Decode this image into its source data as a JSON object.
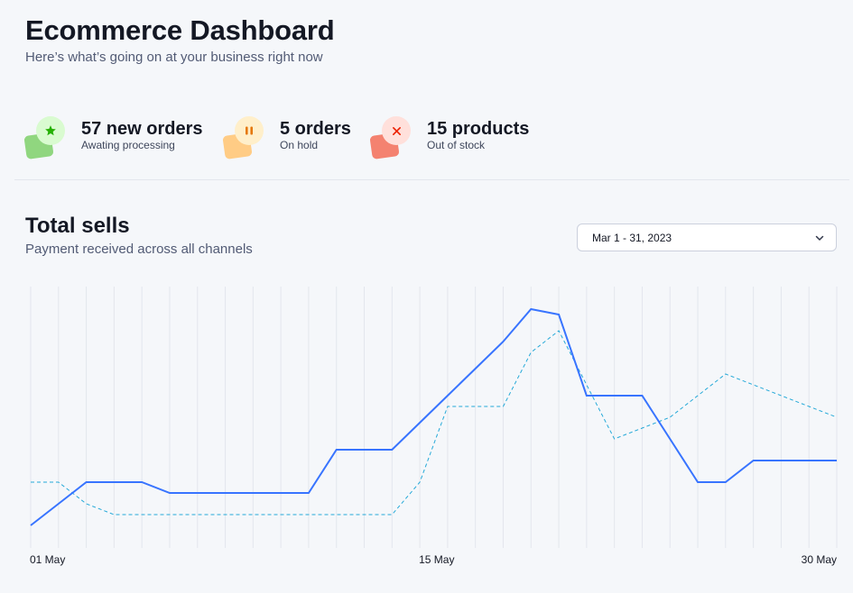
{
  "header": {
    "title": "Ecommerce Dashboard",
    "subtitle": "Here’s what’s going on at your business right now"
  },
  "stats": [
    {
      "value": "57 new orders",
      "label": "Awating processing",
      "icon": "star-icon",
      "color": "#25b003",
      "bg": "#d9fbd0",
      "square": "#90d67f"
    },
    {
      "value": "5 orders",
      "label": "On hold",
      "icon": "pause-icon",
      "color": "#e5780b",
      "bg": "#ffefca",
      "square": "#ffcc85"
    },
    {
      "value": "15 products",
      "label": "Out of stock",
      "icon": "close-icon",
      "color": "#ec1f00",
      "bg": "#ffe0db",
      "square": "#f48270"
    }
  ],
  "sells": {
    "title": "Total sells",
    "subtitle": "Payment received across all channels"
  },
  "date_range": {
    "value": "Mar 1 - 31, 2023",
    "icon": "chevron-down-icon"
  },
  "chart_data": {
    "type": "line",
    "x": [
      1,
      2,
      3,
      4,
      5,
      6,
      7,
      8,
      9,
      10,
      11,
      12,
      13,
      14,
      15,
      16,
      17,
      18,
      19,
      20,
      21,
      22,
      23,
      24,
      25,
      26,
      27,
      28,
      29,
      30
    ],
    "x_tick_labels": [
      {
        "x": 1,
        "label": "01 May"
      },
      {
        "x": 15,
        "label": "15 May"
      },
      {
        "x": 30,
        "label": "30 May"
      }
    ],
    "series": [
      {
        "values": [
          0,
          20,
          40,
          40,
          40,
          30,
          30,
          30,
          30,
          30,
          30,
          70,
          70,
          70,
          95,
          120,
          145,
          170,
          200,
          195,
          120,
          120,
          120,
          80,
          40,
          40,
          60,
          60,
          60,
          60
        ],
        "color": "#3874ff",
        "style": "solid"
      },
      {
        "values": [
          40,
          40,
          20,
          10,
          10,
          10,
          10,
          10,
          10,
          10,
          10,
          10,
          10,
          10,
          40,
          110,
          110,
          110,
          160,
          180,
          130,
          80,
          90,
          100,
          120,
          140,
          130,
          120,
          110,
          100
        ],
        "color": "#25a9d8",
        "style": "dashed"
      }
    ],
    "ylim": [
      0,
      200
    ],
    "grid": "vertical"
  }
}
